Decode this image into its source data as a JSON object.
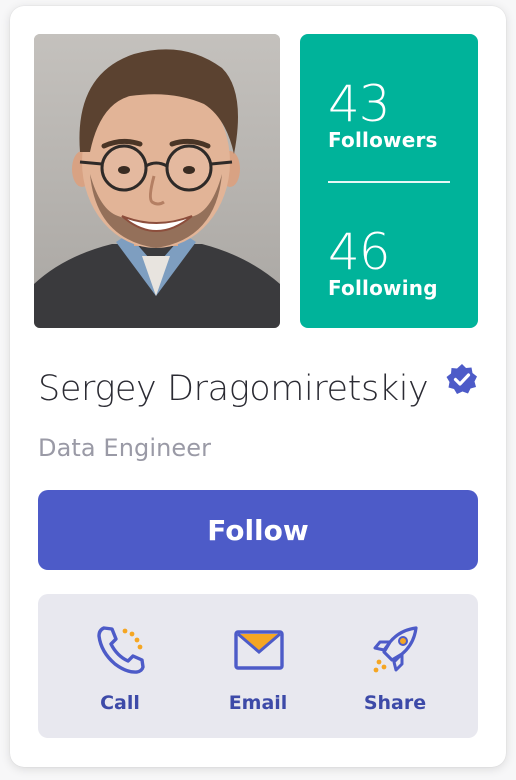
{
  "profile": {
    "name": "Sergey Dragomiretskiy",
    "role": "Data Engineer",
    "verified_icon": "verified-badge-icon",
    "photo_icon": "profile-photo"
  },
  "stats": {
    "followers_count": "43",
    "followers_label": "Followers",
    "following_count": "46",
    "following_label": "Following"
  },
  "buttons": {
    "follow_label": "Follow"
  },
  "actions": [
    {
      "label": "Call",
      "icon": "phone-icon"
    },
    {
      "label": "Email",
      "icon": "envelope-icon"
    },
    {
      "label": "Share",
      "icon": "rocket-icon"
    }
  ],
  "colors": {
    "accent_teal": "#00b39a",
    "primary_blue": "#4d5bc8",
    "icon_orange": "#f5a623",
    "panel_gray": "#e8e8ef"
  }
}
